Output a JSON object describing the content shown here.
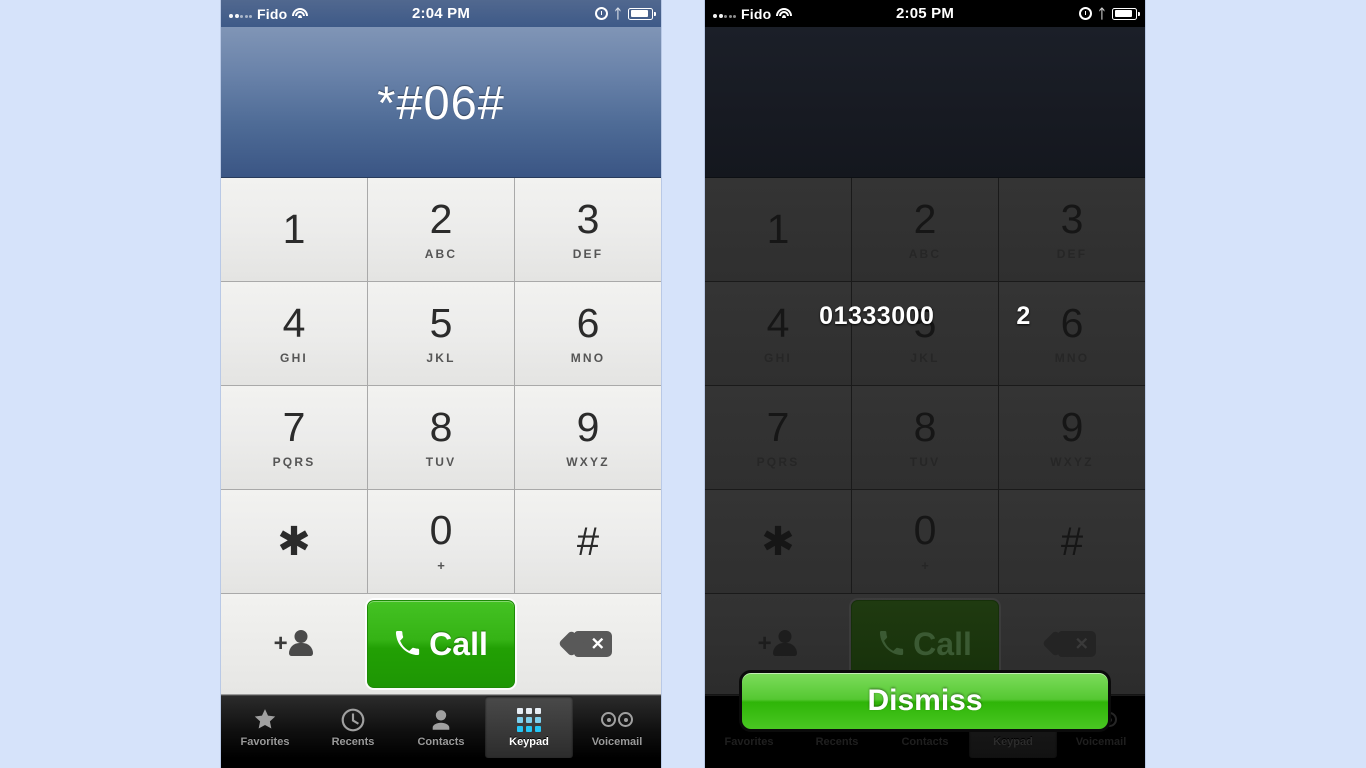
{
  "background_color": "#d6e3fa",
  "phones": [
    {
      "id": "left",
      "state": "dialer",
      "status_bar": {
        "carrier": "Fido",
        "time": "2:04 PM",
        "wifi_icon": "wifi-icon",
        "alarm_icon": "alarm-clock-icon",
        "bluetooth_icon": "bluetooth-icon",
        "battery_icon": "battery-icon",
        "signal_icon": "signal-dots-icon"
      },
      "display": {
        "number": "*#06#"
      }
    },
    {
      "id": "right",
      "state": "imei-alert",
      "status_bar": {
        "carrier": "Fido",
        "time": "2:05 PM",
        "wifi_icon": "wifi-icon",
        "alarm_icon": "alarm-clock-icon",
        "bluetooth_icon": "bluetooth-icon",
        "battery_icon": "battery-icon",
        "signal_icon": "signal-dots-icon"
      },
      "display": {
        "number": ""
      },
      "alert": {
        "imei_head": "01333000",
        "imei_tail": "2",
        "dismiss_label": "Dismiss",
        "dismiss_color": "#3fbf16"
      }
    }
  ],
  "keypad": {
    "keys": [
      {
        "digit": "1",
        "letters": ""
      },
      {
        "digit": "2",
        "letters": "ABC"
      },
      {
        "digit": "3",
        "letters": "DEF"
      },
      {
        "digit": "4",
        "letters": "GHI"
      },
      {
        "digit": "5",
        "letters": "JKL"
      },
      {
        "digit": "6",
        "letters": "MNO"
      },
      {
        "digit": "7",
        "letters": "PQRS"
      },
      {
        "digit": "8",
        "letters": "TUV"
      },
      {
        "digit": "9",
        "letters": "WXYZ"
      },
      {
        "digit": "✱",
        "letters": ""
      },
      {
        "digit": "0",
        "letters": "+"
      },
      {
        "digit": "#",
        "letters": ""
      }
    ]
  },
  "call_row": {
    "add_contact_icon": "add-contact-icon",
    "call_label": "Call",
    "call_icon": "phone-handset-icon",
    "call_color": "#2fb509",
    "delete_icon": "backspace-delete-icon"
  },
  "tab_bar": {
    "active": "Keypad",
    "tabs": [
      {
        "label": "Favorites",
        "icon": "star-icon"
      },
      {
        "label": "Recents",
        "icon": "clock-icon"
      },
      {
        "label": "Contacts",
        "icon": "person-icon"
      },
      {
        "label": "Keypad",
        "icon": "keypad-grid-icon"
      },
      {
        "label": "Voicemail",
        "icon": "voicemail-reels-icon"
      }
    ]
  }
}
